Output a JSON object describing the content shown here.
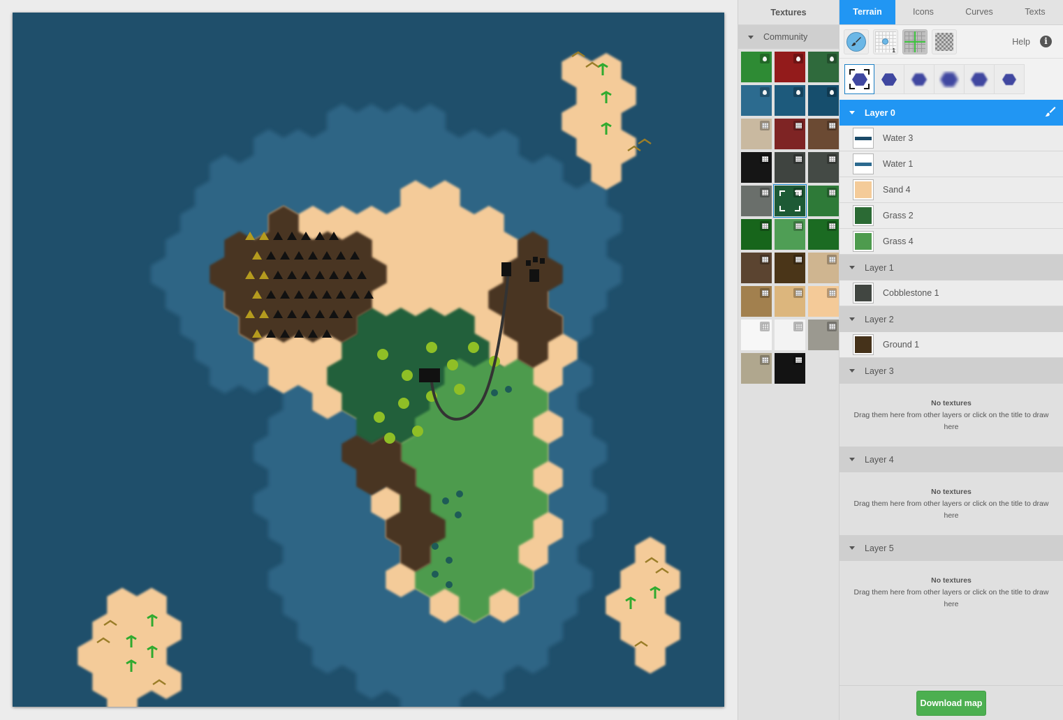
{
  "textures_panel": {
    "title": "Textures",
    "group": "Community",
    "swatches": [
      {
        "color": "#2e8b34",
        "badge": "drop"
      },
      {
        "color": "#931b1b",
        "badge": "drop"
      },
      {
        "color": "#2f6a3c",
        "badge": "drop"
      },
      {
        "color": "#2c6b8f",
        "badge": "drop"
      },
      {
        "color": "#1d5a7c",
        "badge": "drop"
      },
      {
        "color": "#164e6d",
        "badge": "drop"
      },
      {
        "color": "#c9b9a0",
        "badge": "tile"
      },
      {
        "color": "#7e2424",
        "badge": "tile"
      },
      {
        "color": "#6b4a33",
        "badge": "tile"
      },
      {
        "color": "#151515",
        "badge": "tile"
      },
      {
        "color": "#3f4440",
        "badge": "tile"
      },
      {
        "color": "#444a45",
        "badge": "tile"
      },
      {
        "color": "#6a6f6b",
        "badge": "tile"
      },
      {
        "color": "#1d5a35",
        "badge": "tile",
        "selected": true
      },
      {
        "color": "#2e7a38",
        "badge": "tile"
      },
      {
        "color": "#17651b",
        "badge": "tile"
      },
      {
        "color": "#4f9e55",
        "badge": "tile"
      },
      {
        "color": "#1b6b22",
        "badge": "tile"
      },
      {
        "color": "#5b4430",
        "badge": "tile"
      },
      {
        "color": "#4a3518",
        "badge": "tile"
      },
      {
        "color": "#cfb590",
        "badge": "tile"
      },
      {
        "color": "#a2804e",
        "badge": "tile"
      },
      {
        "color": "#dcb67d",
        "badge": "tile"
      },
      {
        "color": "#f4ca98",
        "badge": "tile"
      },
      {
        "color": "#f7f7f7",
        "badge": "tile"
      },
      {
        "color": "#f3f3f3",
        "badge": "tile"
      },
      {
        "color": "#9b9990",
        "badge": "tile"
      },
      {
        "color": "#b0a78e",
        "badge": "tile"
      },
      {
        "color": "#131313",
        "badge": "tile"
      }
    ]
  },
  "tabs": [
    {
      "label": "Terrain",
      "active": true
    },
    {
      "label": "Icons"
    },
    {
      "label": "Curves"
    },
    {
      "label": "Texts"
    }
  ],
  "toolbar": {
    "help_label": "Help",
    "info_glyph": "i",
    "grid_size": "1",
    "tools": [
      "paint-brush",
      "snap-grid",
      "show-grid",
      "transparency"
    ]
  },
  "brush_shapes": [
    "hex-sharp-selected",
    "hex-sharp",
    "hex-soft",
    "hex-blur",
    "hex-rough",
    "hex-round"
  ],
  "layers": [
    {
      "name": "Layer 0",
      "active": true,
      "textures": [
        {
          "name": "Water 3",
          "kind": "bar",
          "color": "#1b4a68"
        },
        {
          "name": "Water 1",
          "kind": "bar",
          "color": "#2c6a8f"
        },
        {
          "name": "Sand 4",
          "kind": "fill",
          "color": "#f4cb99"
        },
        {
          "name": "Grass 2",
          "kind": "fill",
          "color": "#2b6a34"
        },
        {
          "name": "Grass 4",
          "kind": "fill",
          "color": "#4e9b4e"
        }
      ]
    },
    {
      "name": "Layer 1",
      "textures": [
        {
          "name": "Cobblestone 1",
          "kind": "fill",
          "color": "#414641"
        }
      ]
    },
    {
      "name": "Layer 2",
      "textures": [
        {
          "name": "Ground 1",
          "kind": "fill",
          "color": "#45321a"
        }
      ]
    },
    {
      "name": "Layer 3",
      "textures": []
    },
    {
      "name": "Layer 4",
      "textures": []
    },
    {
      "name": "Layer 5",
      "textures": []
    }
  ],
  "empty_layer": {
    "title": "No textures",
    "hint": "Drag them here from other layers or click on the title to draw here"
  },
  "footer": {
    "download_label": "Download map"
  },
  "map_colors": {
    "deep_water": "#1f4f6b",
    "shallow_water": "#2e6585",
    "sand": "#f4cb99",
    "forest": "#23603a",
    "grass": "#4e9b4e",
    "ground": "#4a3620",
    "mountain_border": "#6e6558",
    "road": "#333333"
  }
}
